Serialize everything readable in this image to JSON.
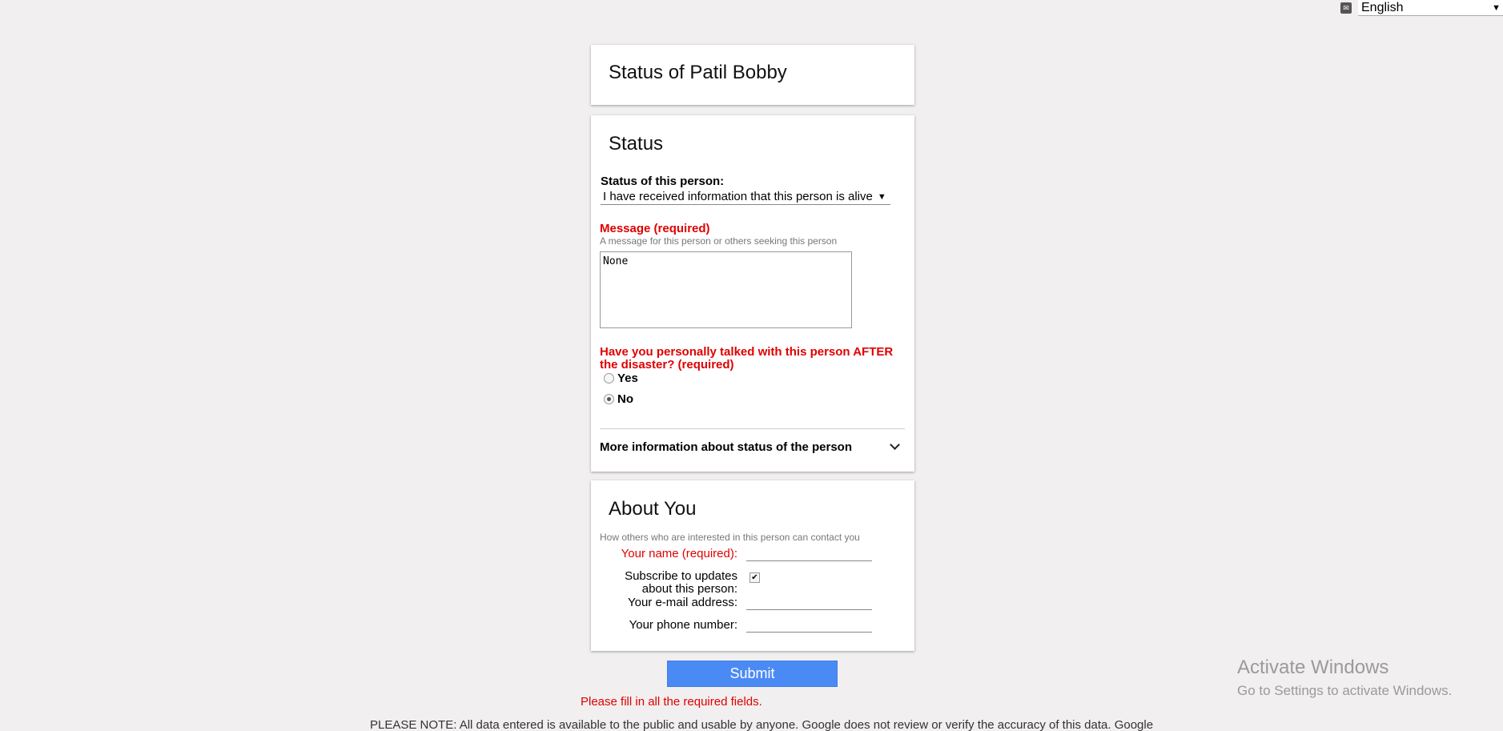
{
  "language": {
    "selected": "English",
    "icon": "language-icon"
  },
  "header_card": {
    "title": "Status of Patil Bobby"
  },
  "status_card": {
    "title": "Status",
    "status_label": "Status of this person:",
    "status_value": "I have received information that this person is alive",
    "message_label": "Message (required)",
    "message_help": "A message for this person or others seeking this person",
    "message_value": "None",
    "talked_question_line1": "Have you personally talked with this person AFTER",
    "talked_question_line2": "the disaster? (required)",
    "options": [
      {
        "label": "Yes",
        "selected": false
      },
      {
        "label": "No",
        "selected": true
      }
    ],
    "more_info_label": "More information about status of the person"
  },
  "about_card": {
    "title": "About You",
    "help": "How others who are interested in this person can contact you",
    "name_label": "Your name (required):",
    "subscribe_label_line1": "Subscribe to updates",
    "subscribe_label_line2": "about this person:",
    "subscribe_checked": true,
    "email_label": "Your e-mail address:",
    "phone_label": "Your phone number:"
  },
  "submit_label": "Submit",
  "error_text": "Please fill in all the required fields.",
  "note_text": "PLEASE NOTE: All data entered is available to the public and usable by anyone. Google does not review or verify the accuracy of this data. Google",
  "watermark": {
    "title": "Activate Windows",
    "subtitle": "Go to Settings to activate Windows."
  },
  "colors": {
    "required": "#e00000",
    "submit": "#4a8af4"
  }
}
